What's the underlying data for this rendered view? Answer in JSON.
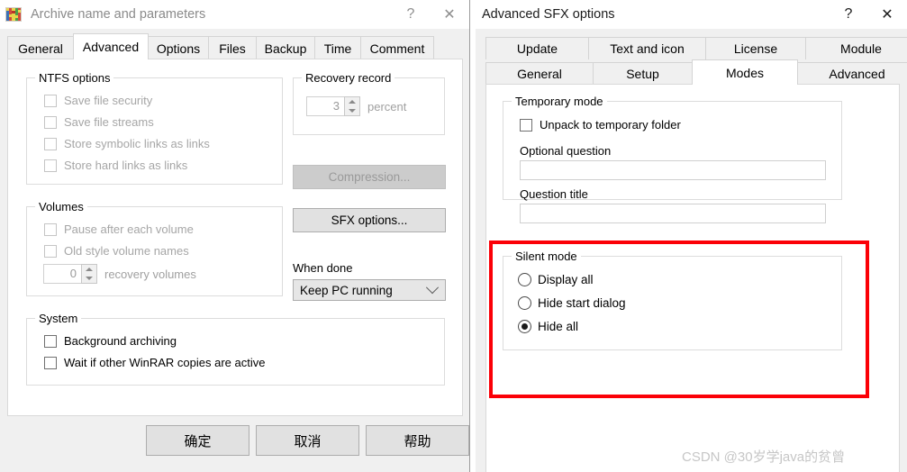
{
  "left_dialog": {
    "title": "Archive name and parameters",
    "icon": "winrar-books-icon",
    "help_glyph": "?",
    "close_glyph": "✕",
    "tabs": [
      {
        "label": "General",
        "selected": false
      },
      {
        "label": "Advanced",
        "selected": true
      },
      {
        "label": "Options",
        "selected": false
      },
      {
        "label": "Files",
        "selected": false
      },
      {
        "label": "Backup",
        "selected": false
      },
      {
        "label": "Time",
        "selected": false
      },
      {
        "label": "Comment",
        "selected": false
      }
    ],
    "ntfs_group": {
      "title": "NTFS options",
      "items": [
        {
          "label": "Save file security",
          "checked": false,
          "disabled": true
        },
        {
          "label": "Save file streams",
          "checked": false,
          "disabled": true
        },
        {
          "label": "Store symbolic links as links",
          "checked": false,
          "disabled": true
        },
        {
          "label": "Store hard links as links",
          "checked": false,
          "disabled": true
        }
      ]
    },
    "volumes_group": {
      "title": "Volumes",
      "items": [
        {
          "label": "Pause after each volume",
          "checked": false,
          "disabled": true
        },
        {
          "label": "Old style volume names",
          "checked": false,
          "disabled": true
        }
      ],
      "recovery_volumes": {
        "value": "0",
        "suffix": "recovery volumes"
      }
    },
    "system_group": {
      "title": "System",
      "items": [
        {
          "label": "Background archiving",
          "checked": false,
          "disabled": false
        },
        {
          "label": "Wait if other WinRAR copies are active",
          "checked": false,
          "disabled": false
        }
      ]
    },
    "recovery_record_group": {
      "title": "Recovery record",
      "value": "3",
      "suffix": "percent"
    },
    "compression_button": {
      "label": "Compression...",
      "disabled": true
    },
    "sfx_button": {
      "label": "SFX options...",
      "disabled": false
    },
    "when_done": {
      "label": "When done",
      "value": "Keep PC running"
    },
    "buttons": [
      {
        "label": "确定"
      },
      {
        "label": "取消"
      },
      {
        "label": "帮助"
      }
    ]
  },
  "right_dialog": {
    "title": "Advanced SFX options",
    "help_glyph": "?",
    "close_glyph": "✕",
    "tabs_top": [
      {
        "label": "Update",
        "selected": false
      },
      {
        "label": "Text and icon",
        "selected": false
      },
      {
        "label": "License",
        "selected": false
      },
      {
        "label": "Module",
        "selected": false
      }
    ],
    "tabs_bottom": [
      {
        "label": "General",
        "selected": false
      },
      {
        "label": "Setup",
        "selected": false
      },
      {
        "label": "Modes",
        "selected": true
      },
      {
        "label": "Advanced",
        "selected": false
      }
    ],
    "temporary_mode_group": {
      "title": "Temporary mode",
      "checkbox": {
        "label": "Unpack to temporary folder",
        "checked": false
      },
      "optional_question": {
        "label": "Optional question",
        "value": ""
      },
      "question_title": {
        "label": "Question title",
        "value": ""
      }
    },
    "silent_mode_group": {
      "title": "Silent mode",
      "options": [
        {
          "label": "Display all",
          "selected": false
        },
        {
          "label": "Hide start dialog",
          "selected": false
        },
        {
          "label": "Hide all",
          "selected": true
        }
      ]
    },
    "highlight_color": "#fb0007"
  },
  "watermark": {
    "text": "CSDN @30岁学java的贫曾"
  }
}
